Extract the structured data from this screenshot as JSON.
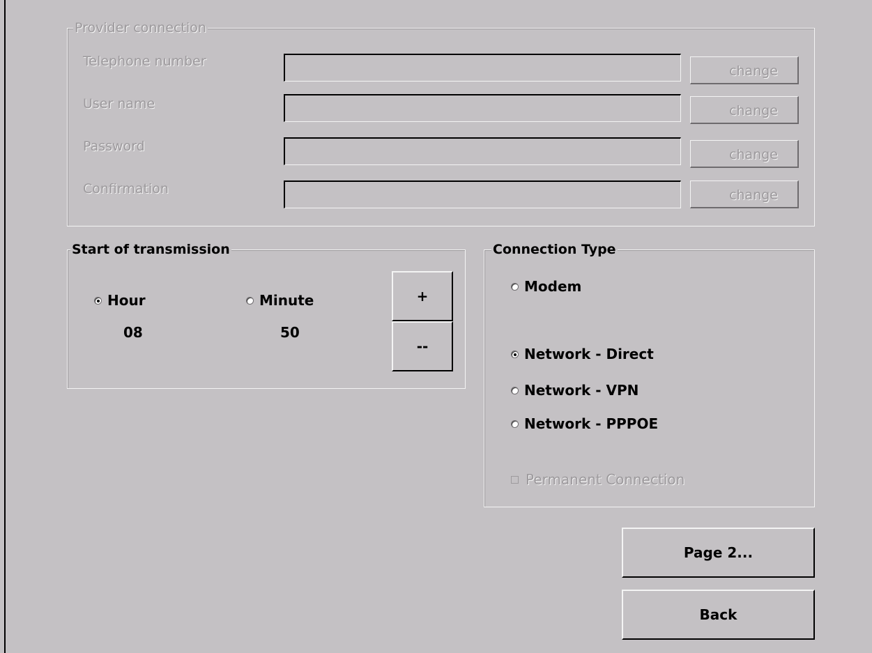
{
  "provider": {
    "legend": "Provider connection",
    "fields": [
      {
        "label": "Telephone number",
        "value": "",
        "button": "change"
      },
      {
        "label": "User name",
        "value": "",
        "button": "change"
      },
      {
        "label": "Password",
        "value": "",
        "button": "change"
      },
      {
        "label": "Confirmation",
        "value": "",
        "button": "change"
      }
    ]
  },
  "transmission": {
    "legend": "Start of transmission",
    "hour_label": "Hour",
    "minute_label": "Minute",
    "hour_value": "08",
    "minute_value": "50",
    "selected": "hour",
    "plus_label": "+",
    "minus_label": "--"
  },
  "connection": {
    "legend": "Connection Type",
    "options": [
      {
        "label": "Modem",
        "selected": false
      },
      {
        "label": "Network - Direct",
        "selected": true
      },
      {
        "label": "Network - VPN",
        "selected": false
      },
      {
        "label": "Network - PPPOE",
        "selected": false
      }
    ],
    "permanent_label": "Permanent Connection",
    "permanent_checked": false
  },
  "actions": {
    "page2": "Page 2...",
    "back": "Back"
  },
  "colors": {
    "background": "#c4c1c4",
    "disabled_text": "#9d9a9d",
    "highlight": "#f4f4f4"
  }
}
